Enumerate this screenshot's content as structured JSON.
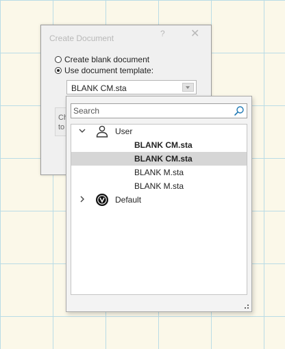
{
  "dialog": {
    "title": "Create Document",
    "help_label": "?",
    "close_label": "✕",
    "options": {
      "blank": {
        "label": "Create blank document",
        "checked": false
      },
      "template": {
        "label": "Use document template:",
        "checked": true
      }
    },
    "template_select": {
      "selected": "BLANK CM.sta"
    },
    "hidden_fragment": {
      "line1": "Ch",
      "line2": "to"
    }
  },
  "dropdown": {
    "search": {
      "value": "",
      "placeholder": "Search"
    },
    "tree": {
      "groups": [
        {
          "name": "User",
          "expanded": true,
          "icon": "user-icon",
          "items": [
            {
              "label": "BLANK CM.sta",
              "bold": true,
              "selected": false
            },
            {
              "label": "BLANK CM.sta",
              "bold": true,
              "selected": true
            },
            {
              "label": "BLANK M.sta",
              "bold": false,
              "selected": false
            },
            {
              "label": "BLANK M.sta",
              "bold": false,
              "selected": false
            }
          ]
        },
        {
          "name": "Default",
          "expanded": false,
          "icon": "default-logo-icon",
          "items": []
        }
      ]
    }
  },
  "colors": {
    "background": "#fbf8e9",
    "grid": "#b9dce6",
    "selection": "#d6d6d6",
    "search_icon": "#1e78b4"
  }
}
